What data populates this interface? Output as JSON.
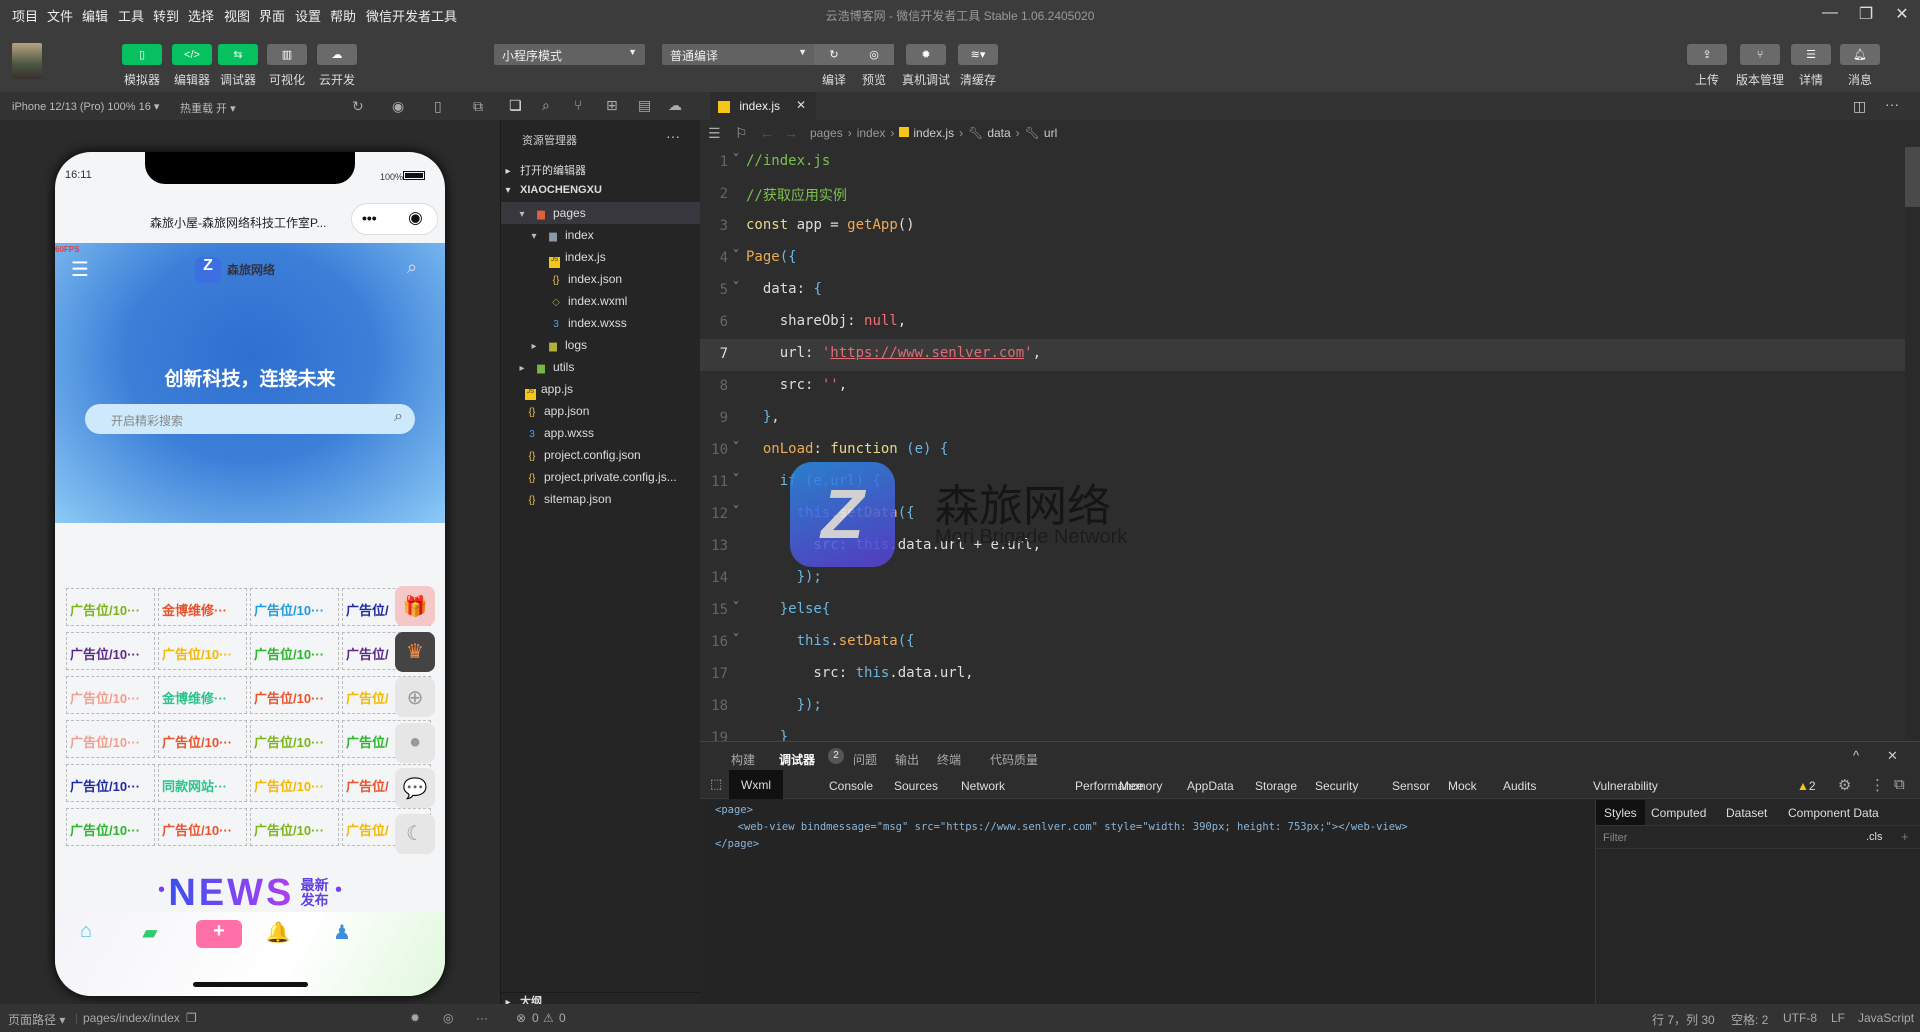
{
  "menu": [
    "项目",
    "文件",
    "编辑",
    "工具",
    "转到",
    "选择",
    "视图",
    "界面",
    "设置",
    "帮助",
    "微信开发者工具"
  ],
  "window_title": "云浩博客网 - 微信开发者工具 Stable 1.06.2405020",
  "toolbar": {
    "left_buttons": [
      {
        "label": "模拟器",
        "icon": "phone-icon"
      },
      {
        "label": "编辑器",
        "icon": "code-icon"
      },
      {
        "label": "调试器",
        "icon": "debug-icon"
      },
      {
        "label": "可视化",
        "icon": "layout-icon"
      },
      {
        "label": "云开发",
        "icon": "cloud-icon"
      }
    ],
    "mode_select": "小程序模式",
    "compile_select": "普通编译",
    "mid_buttons": [
      {
        "label": "编译",
        "icon": "refresh-icon"
      },
      {
        "label": "预览",
        "icon": "eye-icon"
      },
      {
        "label": "真机调试",
        "icon": "bug-icon"
      },
      {
        "label": "清缓存",
        "icon": "layers-icon"
      }
    ],
    "right_buttons": [
      {
        "label": "上传",
        "icon": "upload-icon"
      },
      {
        "label": "版本管理",
        "icon": "branch-icon"
      },
      {
        "label": "详情",
        "icon": "menu-icon"
      },
      {
        "label": "消息",
        "icon": "bell-icon"
      }
    ]
  },
  "simulator": {
    "device": "iPhone 12/13 (Pro) 100% 16 ▾",
    "hot_reload": "热重载 开 ▾"
  },
  "phone": {
    "time": "16:11",
    "battery": "100%",
    "nav_title": "森旅小屋-森旅网络科技工作室P...",
    "fps": "60FPS",
    "logo_text": "森旅网络",
    "headline": "创新科技，连接未来",
    "search_placeholder": "开启精彩搜索",
    "grid": [
      [
        {
          "t": "广告位/10···",
          "c": "#7cb518"
        },
        {
          "t": "金博维修···",
          "c": "#e8532b"
        },
        {
          "t": "广告位/10···",
          "c": "#1e9be0"
        },
        {
          "t": "广告位/",
          "c": "#1f2aa0"
        }
      ],
      [
        {
          "t": "广告位/10···",
          "c": "#5b2a86"
        },
        {
          "t": "广告位/10···",
          "c": "#f5b800"
        },
        {
          "t": "广告位/10···",
          "c": "#2bb52b"
        },
        {
          "t": "广告位/",
          "c": "#5b2a86"
        }
      ],
      [
        {
          "t": "广告位/10···",
          "c": "#f0a090"
        },
        {
          "t": "金博维修···",
          "c": "#2bc48a"
        },
        {
          "t": "广告位/10···",
          "c": "#e8532b"
        },
        {
          "t": "广告位/",
          "c": "#f5b800"
        }
      ],
      [
        {
          "t": "广告位/10···",
          "c": "#f0a090"
        },
        {
          "t": "广告位/10···",
          "c": "#e8532b"
        },
        {
          "t": "广告位/10···",
          "c": "#7cb518"
        },
        {
          "t": "广告位/",
          "c": "#2bb52b"
        }
      ],
      [
        {
          "t": "广告位/10···",
          "c": "#1f2aa0"
        },
        {
          "t": "同款网站···",
          "c": "#2bc48a"
        },
        {
          "t": "广告位/10···",
          "c": "#f5b800"
        },
        {
          "t": "广告位/",
          "c": "#e8532b"
        }
      ],
      [
        {
          "t": "广告位/10···",
          "c": "#2bb52b"
        },
        {
          "t": "广告位/10···",
          "c": "#e8532b"
        },
        {
          "t": "广告位/10···",
          "c": "#7cb518"
        },
        {
          "t": "广告位/",
          "c": "#f5b800"
        }
      ]
    ],
    "float_icons": [
      {
        "icon": "gift-icon",
        "g": "🎁"
      },
      {
        "icon": "crown-icon",
        "g": "♛"
      },
      {
        "icon": "plus-circle-icon",
        "g": "⊕"
      },
      {
        "icon": "qq-icon",
        "g": "●"
      },
      {
        "icon": "wechat-icon",
        "g": "💬"
      },
      {
        "icon": "moon-icon",
        "g": "☾"
      }
    ],
    "news_title": "NEWS",
    "news_sub": "最新发布",
    "tabbar": [
      {
        "icon": "home-icon",
        "g": "⌂",
        "c": "#4fc3f7"
      },
      {
        "icon": "wallet-icon",
        "g": "▰",
        "c": "#2ecc71"
      },
      {
        "icon": "add-icon",
        "g": "+",
        "c": "#ff6fa8"
      },
      {
        "icon": "bell-icon",
        "g": "🔔",
        "c": "#ff8a3d"
      },
      {
        "icon": "user-icon",
        "g": "♟",
        "c": "#3d8de0"
      }
    ]
  },
  "explorer": {
    "title": "资源管理器",
    "open_editors": "打开的编辑器",
    "project": "XIAOCHENGXU",
    "outline": "大纲",
    "items": [
      {
        "name": "pages",
        "depth": 0,
        "icon": "folder-icon",
        "arrow": "▾",
        "color": "#e06040"
      },
      {
        "name": "index",
        "depth": 1,
        "icon": "folder-icon",
        "arrow": "▾",
        "color": "#8a9aa8"
      },
      {
        "name": "index.js",
        "depth": 2,
        "icon": "js-file-icon",
        "color": "#f5c518",
        "g": "JS"
      },
      {
        "name": "index.json",
        "depth": 2,
        "icon": "json-file-icon",
        "color": "#e8c050",
        "g": "{}"
      },
      {
        "name": "index.wxml",
        "depth": 2,
        "icon": "wxml-file-icon",
        "color": "#7cb342",
        "g": "◇"
      },
      {
        "name": "index.wxss",
        "depth": 2,
        "icon": "wxss-file-icon",
        "color": "#42a5f5",
        "g": "3"
      },
      {
        "name": "logs",
        "depth": 1,
        "icon": "folder-icon",
        "arrow": "▸",
        "color": "#b0b040"
      },
      {
        "name": "utils",
        "depth": 0,
        "icon": "folder-icon",
        "arrow": "▸",
        "color": "#7cb342"
      },
      {
        "name": "app.js",
        "depth": 0,
        "icon": "js-file-icon",
        "color": "#f5c518",
        "g": "JS"
      },
      {
        "name": "app.json",
        "depth": 0,
        "icon": "json-file-icon",
        "color": "#e8c050",
        "g": "{}"
      },
      {
        "name": "app.wxss",
        "depth": 0,
        "icon": "wxss-file-icon",
        "color": "#42a5f5",
        "g": "3"
      },
      {
        "name": "project.config.json",
        "depth": 0,
        "icon": "json-file-icon",
        "color": "#e8c050",
        "g": "{}"
      },
      {
        "name": "project.private.config.js...",
        "depth": 0,
        "icon": "json-file-icon",
        "color": "#e8c050",
        "g": "{}"
      },
      {
        "name": "sitemap.json",
        "depth": 0,
        "icon": "json-file-icon",
        "color": "#e8c050",
        "g": "{}"
      }
    ]
  },
  "editor": {
    "tab": "index.js",
    "breadcrumb": [
      "pages",
      "index",
      "index.js",
      "data",
      "url"
    ],
    "watermark": {
      "title": "森旅网络",
      "subtitle": "Mori Brigade Network"
    },
    "current_line": 7,
    "folds": [
      1,
      4,
      5,
      10,
      11,
      12,
      15,
      16
    ],
    "lines": [
      [
        [
          "//index.js",
          "cm"
        ]
      ],
      [
        [
          "//获取应用实例",
          "cm"
        ]
      ],
      [
        [
          "const",
          "kw"
        ],
        [
          " app = ",
          "p"
        ],
        [
          "getApp",
          "fn"
        ],
        [
          "()",
          "p"
        ]
      ],
      [
        [
          "Page",
          "fn"
        ],
        [
          "({",
          "br"
        ]
      ],
      [
        [
          "  data: ",
          "p"
        ],
        [
          "{",
          "br"
        ]
      ],
      [
        [
          "    shareObj: ",
          "p"
        ],
        [
          "null",
          "nl"
        ],
        [
          ",",
          "p"
        ]
      ],
      [
        [
          "    url: ",
          "p"
        ],
        [
          "'",
          "st"
        ],
        [
          "https://www.senlver.com",
          "url"
        ],
        [
          "'",
          "st"
        ],
        [
          ",",
          "p"
        ]
      ],
      [
        [
          "    src: ",
          "p"
        ],
        [
          "''",
          "st"
        ],
        [
          ",",
          "p"
        ]
      ],
      [
        [
          "  }",
          "br"
        ],
        [
          ",",
          "p"
        ]
      ],
      [
        [
          "  onLoad",
          "fn"
        ],
        [
          ": ",
          "p"
        ],
        [
          "function",
          "kw"
        ],
        [
          " (",
          "br"
        ],
        [
          "e",
          "pa"
        ],
        [
          ") {",
          "br"
        ]
      ],
      [
        [
          "    if (e.url) {",
          "br"
        ]
      ],
      [
        [
          "      ",
          "p"
        ],
        [
          "this",
          "th"
        ],
        [
          ".",
          "p"
        ],
        [
          "setData",
          "fn"
        ],
        [
          "({",
          "br"
        ]
      ],
      [
        [
          "        src: ",
          "p"
        ],
        [
          "this",
          "th"
        ],
        [
          ".data.url + e.url,",
          "p"
        ]
      ],
      [
        [
          "      });",
          "br"
        ]
      ],
      [
        [
          "    }else{",
          "br"
        ]
      ],
      [
        [
          "      ",
          "p"
        ],
        [
          "this",
          "th"
        ],
        [
          ".",
          "p"
        ],
        [
          "setData",
          "fn"
        ],
        [
          "({",
          "br"
        ]
      ],
      [
        [
          "        src: ",
          "p"
        ],
        [
          "this",
          "th"
        ],
        [
          ".data.url,",
          "p"
        ]
      ],
      [
        [
          "      });",
          "br"
        ]
      ],
      [
        [
          "    }",
          "br"
        ]
      ]
    ]
  },
  "panel": {
    "tabs": [
      "构建",
      "调试器",
      "问题",
      "输出",
      "终端",
      "代码质量"
    ],
    "debugger_badge": "2",
    "devtools_tabs": [
      "Wxml",
      "Console",
      "Sources",
      "Network",
      "Performance",
      "Memory",
      "AppData",
      "Storage",
      "Security",
      "Sensor",
      "Mock",
      "Audits",
      "Vulnerability"
    ],
    "warnings": "2",
    "wxml": [
      "<page>",
      "  <web-view bindmessage=\"msg\" src=\"https://www.senlver.com\" style=\"width: 390px; height: 753px;\"></web-view>",
      "</page>"
    ],
    "styles_tabs": [
      "Styles",
      "Computed",
      "Dataset",
      "Component Data"
    ],
    "filter_placeholder": "Filter",
    "cls": ".cls"
  },
  "status": {
    "page_path_label": "页面路径 ▾",
    "page_path": "pages/index/index",
    "errors": "0",
    "warnings": "0",
    "cursor": "行 7，列 30",
    "spaces": "空格: 2",
    "encoding": "UTF-8",
    "eol": "LF",
    "language": "JavaScript"
  }
}
